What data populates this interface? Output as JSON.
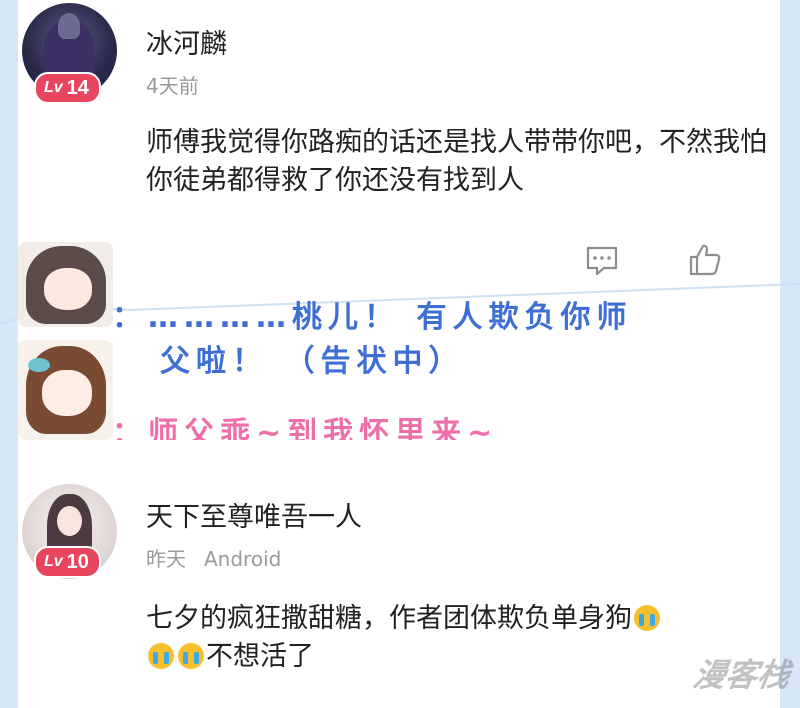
{
  "comments": [
    {
      "username": "冰河麟",
      "level_prefix": "Lv",
      "level": "14",
      "time": "4天前",
      "device": "",
      "text": "师傅我觉得你路痴的话还是找人带带你吧，不然我怕你徒弟都得救了你还没有找到人"
    },
    {
      "username": "天下至尊唯吾一人",
      "level_prefix": "Lv",
      "level": "10",
      "time": "昨天",
      "device": "Android",
      "text_before": "七夕的疯狂撒甜糖，作者团体欺负单身狗",
      "text_after": "不想活了"
    }
  ],
  "speech": {
    "line1a": "：…………桃儿！ 有人欺负你师",
    "line1b": "父啦！ （告状中）",
    "line2": "：师父乖~到我怀里来~"
  },
  "icons": [
    "comment-icon",
    "like-icon",
    "crying-emoji-icon"
  ],
  "colors": {
    "badge": "#e8455f",
    "speech_blue": "#3f6fd3",
    "speech_pink": "#ee6fa8",
    "frame_blue": "#d7e7f8"
  },
  "watermark": "漫客栈"
}
